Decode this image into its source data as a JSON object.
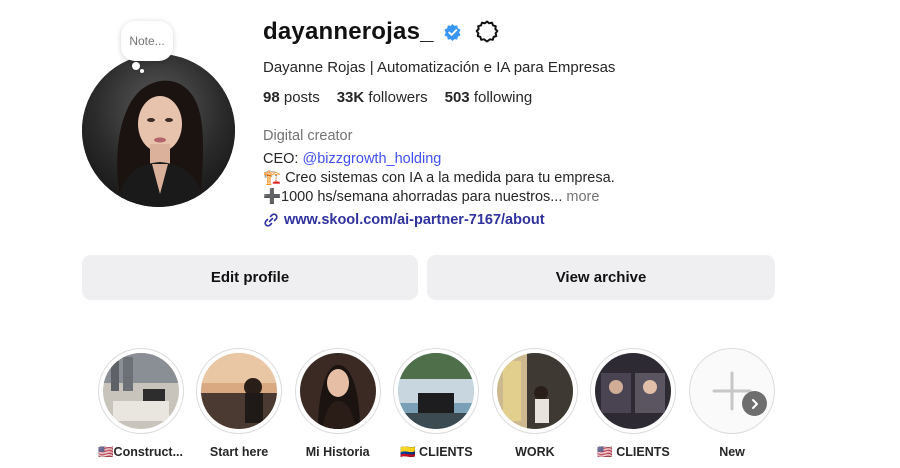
{
  "profile": {
    "username": "dayannerojas_",
    "full_name": "Dayanne Rojas | Automatización e IA para Empresas",
    "note_placeholder": "Note...",
    "verified": true
  },
  "stats": {
    "posts_count": "98",
    "posts_label": "posts",
    "followers_count": "33K",
    "followers_label": "followers",
    "following_count": "503",
    "following_label": "following"
  },
  "bio": {
    "category": "Digital creator",
    "line1_prefix": "CEO: ",
    "line1_mention": "@bizzgrowth_holding",
    "line2": "🏗️ Creo sistemas con IA a la medida para tu empresa.",
    "line3": "➕1000 hs/semana ahorradas para nuestros...",
    "more_label": "more",
    "link": "www.skool.com/ai-partner-7167/about"
  },
  "buttons": {
    "edit_profile": "Edit profile",
    "view_archive": "View archive"
  },
  "highlights": [
    {
      "label": "🇺🇸Construct..."
    },
    {
      "label": "Start here"
    },
    {
      "label": "Mi Historia"
    },
    {
      "label": "🇨🇴 CLIENTS"
    },
    {
      "label": "WORK"
    },
    {
      "label": "🇺🇸 CLIENTS"
    },
    {
      "label": "New"
    }
  ],
  "colors": {
    "verified_blue": "#3897f0",
    "mention_blue": "#4150f7",
    "link_blue": "#30329e",
    "button_bg": "#efeff1"
  },
  "icons": [
    "verified-badge-icon",
    "gear-icon",
    "link-icon",
    "plus-icon",
    "chevron-right-icon"
  ]
}
